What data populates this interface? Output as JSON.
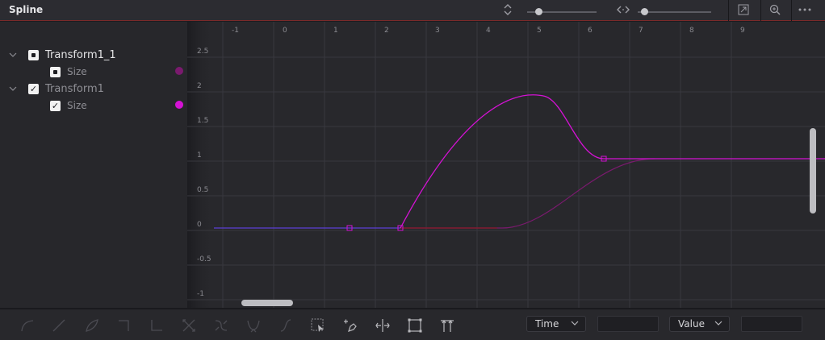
{
  "panel": {
    "title": "Spline"
  },
  "titlebar_icons": [
    "vertical-resize-icon",
    "zoom-slider-y",
    "horizontal-resize-icon",
    "zoom-slider-x",
    "fit-view-icon",
    "zoom-icon",
    "more-options-icon"
  ],
  "zoom_sliders": {
    "vertical_level": 0.18,
    "horizontal_level": 0.07
  },
  "tree": {
    "items": [
      {
        "label": "Transform1_1",
        "checked": false,
        "expanded": true
      },
      {
        "label": "Size",
        "checked": false,
        "color": "#7a1a6e"
      },
      {
        "label": "Transform1",
        "checked": true,
        "expanded": true
      },
      {
        "label": "Size",
        "checked": true,
        "color": "#d412d4"
      }
    ]
  },
  "graph": {
    "x_ticks": [
      "-1",
      "0",
      "1",
      "2",
      "3",
      "4",
      "5",
      "6",
      "7",
      "8",
      "9"
    ],
    "y_ticks": [
      "2.5",
      "2",
      "1.5",
      "1",
      "0.5",
      "0",
      "-0.5",
      "-1"
    ],
    "keyframes": [
      {
        "t": 1,
        "v": 0
      },
      {
        "t": 2,
        "v": 0
      },
      {
        "t": 6,
        "v": 1
      }
    ],
    "curve_colors": {
      "active": "#d412d4",
      "inactive": "#7a1a6e",
      "pre": "#5b3fd6",
      "dim": "#8a1a2a"
    }
  },
  "toolbar": {
    "tools": [
      "smooth-icon",
      "linear-icon",
      "invert-icon",
      "step-in-icon",
      "step-out-icon",
      "reverse-icon",
      "ping-pong-icon",
      "set-loop-icon",
      "relative-loop-icon",
      "select-all-icon",
      "add-point-icon",
      "time-stretch-icon",
      "shape-box-icon",
      "show-key-markers-icon"
    ],
    "time_label": "Time",
    "value_label": "Value"
  }
}
